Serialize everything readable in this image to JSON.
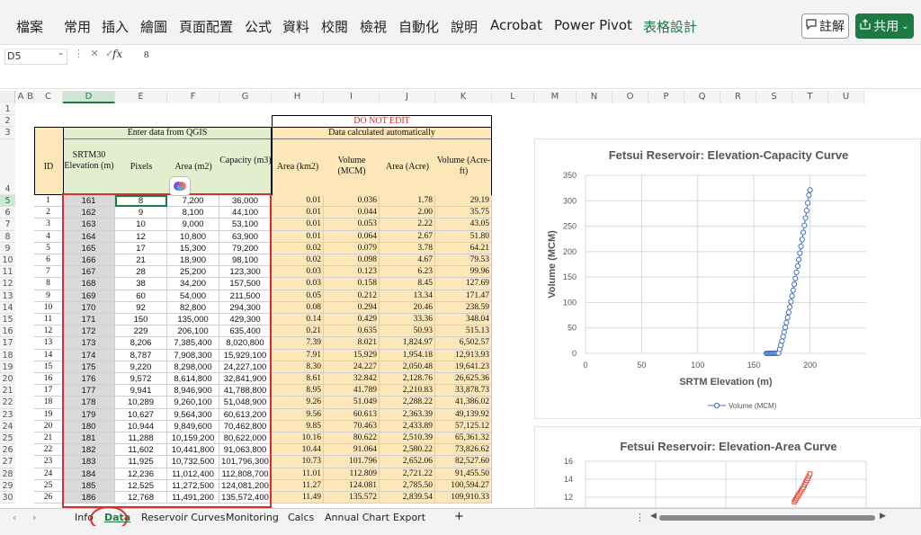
{
  "ribbon": {
    "menus": [
      "檔案",
      "常用",
      "插入",
      "繪圖",
      "頁面配置",
      "公式",
      "資料",
      "校閱",
      "檢視",
      "自動化",
      "說明",
      "Acrobat",
      "Power Pivot",
      "表格設計"
    ],
    "comment_label": "註解",
    "share_label": "共用"
  },
  "formula_bar": {
    "name_box": "D5",
    "fx": "fx",
    "value": "8"
  },
  "columns": [
    "A",
    "B",
    "C",
    "D",
    "E",
    "F",
    "G",
    "H",
    "I",
    "J",
    "K",
    "L",
    "M",
    "N",
    "O",
    "P",
    "Q",
    "R",
    "S",
    "T",
    "U"
  ],
  "header": {
    "group_qgis": "Enter data from QGIS",
    "do_not_edit": "DO NOT EDIT",
    "calc_auto": "Data calculated automatically",
    "id": "ID",
    "elev": "SRTM30 Elevation (m)",
    "pixels": "Pixels",
    "area_m2": "Area (m2)",
    "capacity": "Capacity (m3)",
    "area_km2": "Area (km2)",
    "volume_mcm": "Volume (MCM)",
    "area_acre": "Area (Acre)",
    "volume_acreft": "Volume (Acre-ft)"
  },
  "rows": [
    [
      "1",
      "161",
      "8",
      "7,200",
      "36,000",
      "0.01",
      "0.036",
      "1.78",
      "29.19"
    ],
    [
      "2",
      "162",
      "9",
      "8,100",
      "44,100",
      "0.01",
      "0.044",
      "2.00",
      "35.75"
    ],
    [
      "3",
      "163",
      "10",
      "9,000",
      "53,100",
      "0.01",
      "0.053",
      "2.22",
      "43.05"
    ],
    [
      "4",
      "164",
      "12",
      "10,800",
      "63,900",
      "0.01",
      "0.064",
      "2.67",
      "51.80"
    ],
    [
      "5",
      "165",
      "17",
      "15,300",
      "79,200",
      "0.02",
      "0.079",
      "3.78",
      "64.21"
    ],
    [
      "6",
      "166",
      "21",
      "18,900",
      "98,100",
      "0.02",
      "0.098",
      "4.67",
      "79.53"
    ],
    [
      "7",
      "167",
      "28",
      "25,200",
      "123,300",
      "0.03",
      "0.123",
      "6.23",
      "99.96"
    ],
    [
      "8",
      "168",
      "38",
      "34,200",
      "157,500",
      "0.03",
      "0.158",
      "8.45",
      "127.69"
    ],
    [
      "9",
      "169",
      "60",
      "54,000",
      "211,500",
      "0.05",
      "0.212",
      "13.34",
      "171.47"
    ],
    [
      "10",
      "170",
      "92",
      "82,800",
      "294,300",
      "0.08",
      "0.294",
      "20.46",
      "238.59"
    ],
    [
      "11",
      "171",
      "150",
      "135,000",
      "429,300",
      "0.14",
      "0.429",
      "33.36",
      "348.04"
    ],
    [
      "12",
      "172",
      "229",
      "206,100",
      "635,400",
      "0.21",
      "0.635",
      "50.93",
      "515.13"
    ],
    [
      "13",
      "173",
      "8,206",
      "7,385,400",
      "8,020,800",
      "7.39",
      "8.021",
      "1,824.97",
      "6,502.57"
    ],
    [
      "14",
      "174",
      "8,787",
      "7,908,300",
      "15,929,100",
      "7.91",
      "15.929",
      "1,954.18",
      "12,913.93"
    ],
    [
      "15",
      "175",
      "9,220",
      "8,298,000",
      "24,227,100",
      "8.30",
      "24.227",
      "2,050.48",
      "19,641.23"
    ],
    [
      "16",
      "176",
      "9,572",
      "8,614,800",
      "32,841,900",
      "8.61",
      "32.842",
      "2,128.76",
      "26,625.36"
    ],
    [
      "17",
      "177",
      "9,941",
      "8,946,900",
      "41,788,800",
      "8.95",
      "41.789",
      "2,210.83",
      "33,878.73"
    ],
    [
      "18",
      "178",
      "10,289",
      "9,260,100",
      "51,048,900",
      "9.26",
      "51.049",
      "2,288.22",
      "41,386.02"
    ],
    [
      "19",
      "179",
      "10,627",
      "9,564,300",
      "60,613,200",
      "9.56",
      "60.613",
      "2,363.39",
      "49,139.92"
    ],
    [
      "20",
      "180",
      "10,944",
      "9,849,600",
      "70,462,800",
      "9.85",
      "70.463",
      "2,433.89",
      "57,125.12"
    ],
    [
      "21",
      "181",
      "11,288",
      "10,159,200",
      "80,622,000",
      "10.16",
      "80.622",
      "2,510.39",
      "65,361.32"
    ],
    [
      "22",
      "182",
      "11,602",
      "10,441,800",
      "91,063,800",
      "10.44",
      "91.064",
      "2,580.22",
      "73,826.62"
    ],
    [
      "23",
      "183",
      "11,925",
      "10,732,500",
      "101,796,300",
      "10.73",
      "101.796",
      "2,652.06",
      "82,527.60"
    ],
    [
      "24",
      "184",
      "12,236",
      "11,012,400",
      "112,808,700",
      "11.01",
      "112.809",
      "2,721.22",
      "91,455.50"
    ],
    [
      "25",
      "185",
      "12,525",
      "11,272,500",
      "124,081,200",
      "11.27",
      "124.081",
      "2,785.50",
      "100,594.27"
    ],
    [
      "26",
      "186",
      "12,768",
      "11,491,200",
      "135,572,400",
      "11.49",
      "135.572",
      "2,839.54",
      "109,910.33"
    ]
  ],
  "chart_data": [
    {
      "type": "scatter",
      "title": "Fetsui Reservoir: Elevation-Capacity Curve",
      "xlabel": "SRTM Elevation (m)",
      "ylabel": "Volume (MCM)",
      "xlim": [
        0,
        250
      ],
      "ylim": [
        0,
        350
      ],
      "xticks": [
        "0",
        "50",
        "100",
        "150",
        "200"
      ],
      "yticks": [
        "0",
        "50",
        "100",
        "150",
        "200",
        "250",
        "300",
        "350"
      ],
      "legend": "bottom",
      "grid": true,
      "series": [
        {
          "name": "Volume (MCM)",
          "color": "#4472c4",
          "x": [
            161,
            162,
            163,
            164,
            165,
            166,
            167,
            168,
            169,
            170,
            171,
            172,
            173,
            174,
            175,
            176,
            177,
            178,
            179,
            180,
            181,
            182,
            183,
            184,
            185,
            186,
            187,
            188,
            189,
            190,
            191,
            192,
            193,
            194,
            195,
            196,
            197,
            198,
            199,
            200
          ],
          "values": [
            0.036,
            0.044,
            0.053,
            0.064,
            0.079,
            0.098,
            0.123,
            0.158,
            0.212,
            0.294,
            0.429,
            0.635,
            8.021,
            15.929,
            24.227,
            32.842,
            41.789,
            51.049,
            60.613,
            70.463,
            80.622,
            91.064,
            101.796,
            112.809,
            124.081,
            135.572,
            147.3,
            159.3,
            171.6,
            184.2,
            197.1,
            210.3,
            223.8,
            237.6,
            251.7,
            266.1,
            280.8,
            295.8,
            311.1,
            321
          ]
        }
      ]
    },
    {
      "type": "scatter",
      "title": "Fetsui Reservoir: Elevation-Area Curve",
      "xlabel": "",
      "ylabel": "",
      "ylim": [
        10,
        16
      ],
      "yticks": [
        "16",
        "14",
        "12"
      ],
      "grid": true,
      "series": [
        {
          "color": "#e8402f",
          "x": [
            186,
            187,
            188,
            189,
            190,
            191,
            192,
            193,
            194,
            195,
            196,
            197,
            198,
            199,
            200
          ],
          "values": [
            11.49,
            11.7,
            11.9,
            12.1,
            12.3,
            12.5,
            12.7,
            12.9,
            13.1,
            13.35,
            13.6,
            13.85,
            14.1,
            14.35,
            14.6
          ]
        }
      ]
    }
  ],
  "sheet_tabs": [
    "Info",
    "Data",
    "Reservoir Curves",
    "Monitoring",
    "Calcs",
    "Annual Chart",
    "Export",
    "+"
  ],
  "active_tab": "Data",
  "annotation_color": "#d32f2f"
}
